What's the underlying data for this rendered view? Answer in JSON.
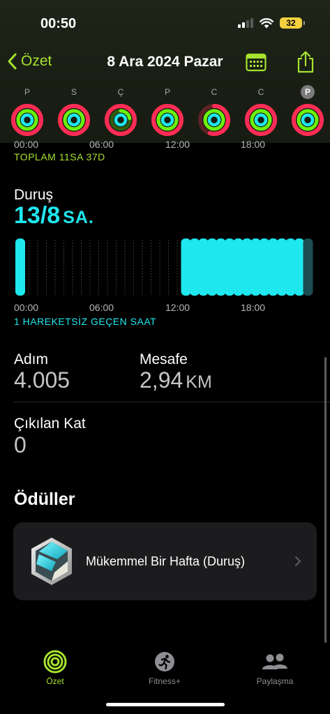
{
  "status_bar": {
    "time": "00:50",
    "battery": "32"
  },
  "nav": {
    "back_label": "Özet",
    "title": "8 Ara 2024 Pazar"
  },
  "week": [
    {
      "letter": "P",
      "selected": false,
      "rings": {
        "move": 1.0,
        "exercise": 1.0,
        "stand": 1.0
      }
    },
    {
      "letter": "S",
      "selected": false,
      "rings": {
        "move": 1.0,
        "exercise": 1.0,
        "stand": 1.0
      }
    },
    {
      "letter": "Ç",
      "selected": false,
      "rings": {
        "move": 1.0,
        "exercise": 0.22,
        "stand": 1.0
      }
    },
    {
      "letter": "P",
      "selected": false,
      "rings": {
        "move": 1.0,
        "exercise": 1.0,
        "stand": 1.0
      }
    },
    {
      "letter": "C",
      "selected": false,
      "rings": {
        "move": 0.55,
        "exercise": 1.0,
        "stand": 1.0
      }
    },
    {
      "letter": "C",
      "selected": false,
      "rings": {
        "move": 1.0,
        "exercise": 1.0,
        "stand": 1.0
      }
    },
    {
      "letter": "P",
      "selected": true,
      "rings": {
        "move": 1.0,
        "exercise": 1.0,
        "stand": 1.0
      }
    }
  ],
  "hour_labels": [
    "00:00",
    "06:00",
    "12:00",
    "18:00"
  ],
  "exercise_total": "TOPLAM 11SA 37D",
  "stand": {
    "title": "Duruş",
    "value": "13/8",
    "unit": "SA.",
    "hours": [
      1,
      0,
      0,
      0,
      0,
      0,
      0,
      0,
      0,
      0,
      0,
      0,
      0,
      0,
      0,
      0,
      0,
      0,
      0,
      1,
      1,
      1,
      1,
      1,
      1,
      1,
      1,
      1,
      1,
      1,
      1,
      1,
      1,
      0.4
    ],
    "idle_note": "1 HAREKETSİZ GEÇEN SAAT"
  },
  "metrics": {
    "steps": {
      "label": "Adım",
      "value": "4.005"
    },
    "distance": {
      "label": "Mesafe",
      "value": "2,94",
      "unit": "KM"
    },
    "floors": {
      "label": "Çıkılan Kat",
      "value": "0"
    }
  },
  "awards": {
    "title": "Ödüller",
    "item_label": "Mükemmel Bir Hafta (Duruş)"
  },
  "tabs": [
    {
      "label": "Özet",
      "active": true
    },
    {
      "label": "Fitness+",
      "active": false
    },
    {
      "label": "Paylaşma",
      "active": false
    }
  ],
  "colors": {
    "accent": "#a6e22e",
    "move": "#ff2d55",
    "exercise": "#6cf20b",
    "stand": "#1fe7ee",
    "stand_inactive": "#1b4d52"
  }
}
